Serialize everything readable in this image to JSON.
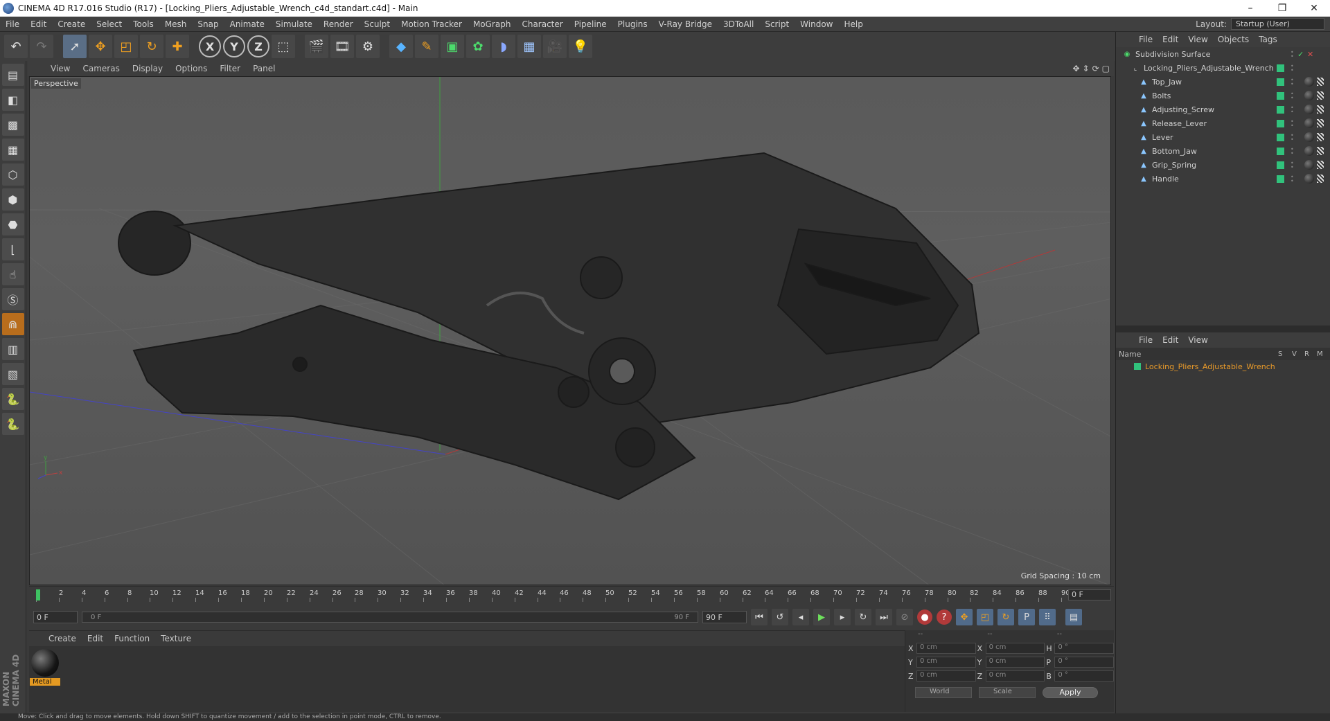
{
  "window": {
    "title": "CINEMA 4D R17.016 Studio (R17) - [Locking_Pliers_Adjustable_Wrench_c4d_standart.c4d] - Main",
    "minimize": "–",
    "maximize": "❐",
    "close": "✕"
  },
  "menubar": {
    "items": [
      "File",
      "Edit",
      "Create",
      "Select",
      "Tools",
      "Mesh",
      "Snap",
      "Animate",
      "Simulate",
      "Render",
      "Sculpt",
      "Motion Tracker",
      "MoGraph",
      "Character",
      "Pipeline",
      "Plugins",
      "V-Ray Bridge",
      "3DToAll",
      "Script",
      "Window",
      "Help"
    ],
    "layout_label": "Layout:",
    "layout_value": "Startup (User)"
  },
  "toolbar": {
    "icons": [
      "undo-icon",
      "redo-icon",
      "live-selection-icon",
      "move-icon",
      "scale-icon",
      "rotate-icon",
      "add-icon",
      "x-axis-icon",
      "y-axis-icon",
      "z-axis-icon",
      "coordinate-system-icon",
      "render-view-icon",
      "render-picture-viewer-icon",
      "edit-render-settings-icon",
      "cube-icon",
      "pen-icon",
      "subdivision-icon",
      "cloner-icon",
      "deformer-icon",
      "floor-icon",
      "camera-icon",
      "light-icon"
    ],
    "axis_x": "X",
    "axis_y": "Y",
    "axis_z": "Z"
  },
  "viewport": {
    "menu": [
      "View",
      "Cameras",
      "Display",
      "Options",
      "Filter",
      "Panel"
    ],
    "label": "Perspective",
    "grid_spacing": "Grid Spacing : 10 cm"
  },
  "timeline": {
    "ticks": [
      "0",
      "2",
      "4",
      "6",
      "8",
      "10",
      "12",
      "14",
      "16",
      "18",
      "20",
      "22",
      "24",
      "26",
      "28",
      "30",
      "32",
      "34",
      "36",
      "38",
      "40",
      "42",
      "44",
      "46",
      "48",
      "50",
      "52",
      "54",
      "56",
      "58",
      "60",
      "62",
      "64",
      "66",
      "68",
      "70",
      "72",
      "74",
      "76",
      "78",
      "80",
      "82",
      "84",
      "86",
      "88",
      "90"
    ],
    "current_frame": "0 F"
  },
  "transport": {
    "start": "0 F",
    "slider_start": "0 F",
    "slider_end": "90 F",
    "end": "90 F"
  },
  "material": {
    "menu": [
      "Create",
      "Edit",
      "Function",
      "Texture"
    ],
    "name": "Metal"
  },
  "coords": {
    "headers": [
      "--",
      "--",
      "--"
    ],
    "rows": [
      {
        "a": "X",
        "v1": "0 cm",
        "b": "X",
        "v2": "0 cm",
        "c": "H",
        "v3": "0 °"
      },
      {
        "a": "Y",
        "v1": "0 cm",
        "b": "Y",
        "v2": "0 cm",
        "c": "P",
        "v3": "0 °"
      },
      {
        "a": "Z",
        "v1": "0 cm",
        "b": "Z",
        "v2": "0 cm",
        "c": "B",
        "v3": "0 °"
      }
    ],
    "world": "World",
    "scale": "Scale",
    "apply": "Apply"
  },
  "objects_panel": {
    "menu": [
      "File",
      "Edit",
      "View",
      "Objects",
      "Tags"
    ],
    "tree": [
      {
        "name": "Subdivision Surface",
        "level": 0
      },
      {
        "name": "Locking_Pliers_Adjustable_Wrench",
        "level": 1
      },
      {
        "name": "Top_Jaw",
        "level": 2
      },
      {
        "name": "Bolts",
        "level": 2
      },
      {
        "name": "Adjusting_Screw",
        "level": 2
      },
      {
        "name": "Release_Lever",
        "level": 2
      },
      {
        "name": "Lever",
        "level": 2
      },
      {
        "name": "Bottom_Jaw",
        "level": 2
      },
      {
        "name": "Grip_Spring",
        "level": 2
      },
      {
        "name": "Handle",
        "level": 2
      }
    ]
  },
  "layers_panel": {
    "menu": [
      "File",
      "Edit",
      "View"
    ],
    "columns": {
      "name": "Name",
      "s": "S",
      "v": "V",
      "r": "R",
      "m": "M"
    },
    "row": "Locking_Pliers_Adjustable_Wrench"
  },
  "status": "Move: Click and drag to move elements. Hold down SHIFT to quantize movement / add to the selection in point mode, CTRL to remove.",
  "brand": "MAXON CINEMA 4D",
  "colors": {
    "accent": "#e49a22",
    "tag_green": "#31c27c",
    "viewport_bg": "#5a5a5a"
  }
}
